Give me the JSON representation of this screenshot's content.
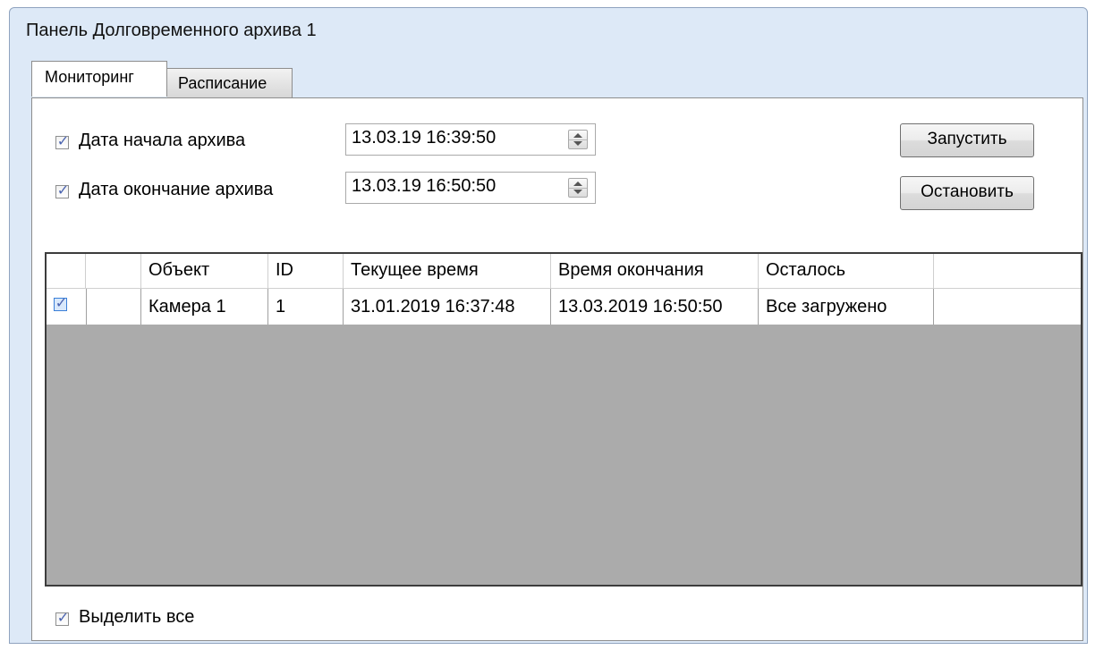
{
  "window": {
    "title": "Панель Долговременного архива 1"
  },
  "tabs": [
    {
      "label": "Мониторинг",
      "active": true
    },
    {
      "label": "Расписание",
      "active": false
    }
  ],
  "filters": {
    "start": {
      "label": "Дата начала архива",
      "checked": true,
      "value": "13.03.19 16:39:50"
    },
    "end": {
      "label": "Дата окончание архива",
      "checked": true,
      "value": "13.03.19 16:50:50"
    }
  },
  "buttons": {
    "start_label": "Запустить",
    "stop_label": "Остановить"
  },
  "table": {
    "columns": [
      "",
      "",
      "Объект",
      "ID",
      "Текущее время",
      "Время окончания",
      "Осталось",
      ""
    ],
    "rows": [
      {
        "checked": true,
        "cells": [
          "",
          "Камера 1",
          "1",
          "31.01.2019 16:37:48",
          "13.03.2019 16:50:50",
          "Все загружено",
          ""
        ]
      }
    ]
  },
  "select_all": {
    "label": "Выделить все",
    "checked": true
  },
  "icons": {
    "checkbox": "checkmark-icon",
    "spinner": "spin-updown-icon"
  },
  "colors": {
    "window_bg": "#dde9f7",
    "grid_empty_bg": "#ababab",
    "check_color": "#4a63b0"
  }
}
